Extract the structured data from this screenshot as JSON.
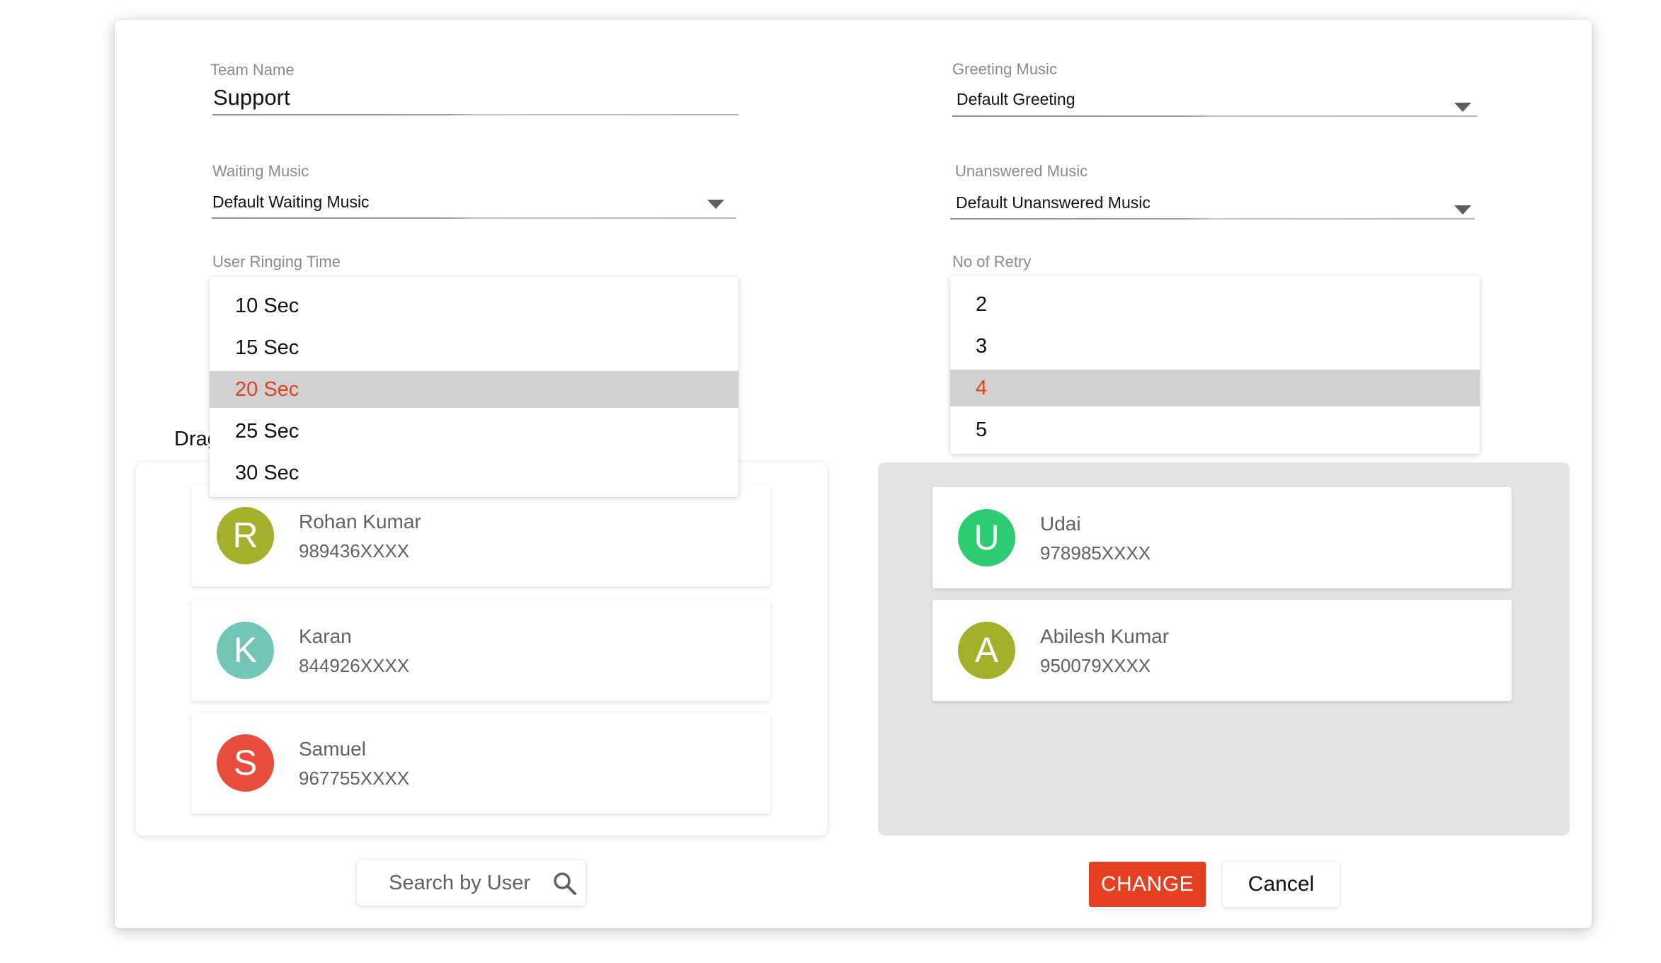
{
  "form": {
    "team_name": {
      "label": "Team Name",
      "value": "Support"
    },
    "greeting_music": {
      "label": "Greeting Music",
      "value": "Default Greeting"
    },
    "waiting_music": {
      "label": "Waiting Music",
      "value": "Default Waiting Music"
    },
    "unanswered_music": {
      "label": "Unanswered Music",
      "value": "Default Unanswered Music"
    },
    "user_ringing_time": {
      "label": "User Ringing Time",
      "options": [
        "10 Sec",
        "15 Sec",
        "20 Sec",
        "25 Sec",
        "30 Sec"
      ],
      "selected": "20 Sec"
    },
    "no_of_retry": {
      "label": "No of Retry",
      "options": [
        "2",
        "3",
        "4",
        "5"
      ],
      "selected": "4"
    }
  },
  "drag_label": "Drag",
  "available_users": [
    {
      "initial": "R",
      "name": "Rohan Kumar",
      "phone": "989436XXXX",
      "color": "#a4b02b"
    },
    {
      "initial": "K",
      "name": "Karan",
      "phone": "844926XXXX",
      "color": "#73c6b6"
    },
    {
      "initial": "S",
      "name": "Samuel",
      "phone": "967755XXXX",
      "color": "#e74c3c"
    }
  ],
  "team_users": [
    {
      "initial": "U",
      "name": "Udai",
      "phone": "978985XXXX",
      "color": "#2ecc71"
    },
    {
      "initial": "A",
      "name": "Abilesh Kumar",
      "phone": "950079XXXX",
      "color": "#a4b02b"
    }
  ],
  "search": {
    "placeholder": "Search by User",
    "icon": "search-icon"
  },
  "actions": {
    "change_label": "CHANGE",
    "cancel_label": "Cancel"
  },
  "colors": {
    "accent": "#e64022",
    "selected_text": "#e0401f",
    "selected_bg": "#d1d1d1",
    "team_panel_bg": "#e4e4e4"
  }
}
